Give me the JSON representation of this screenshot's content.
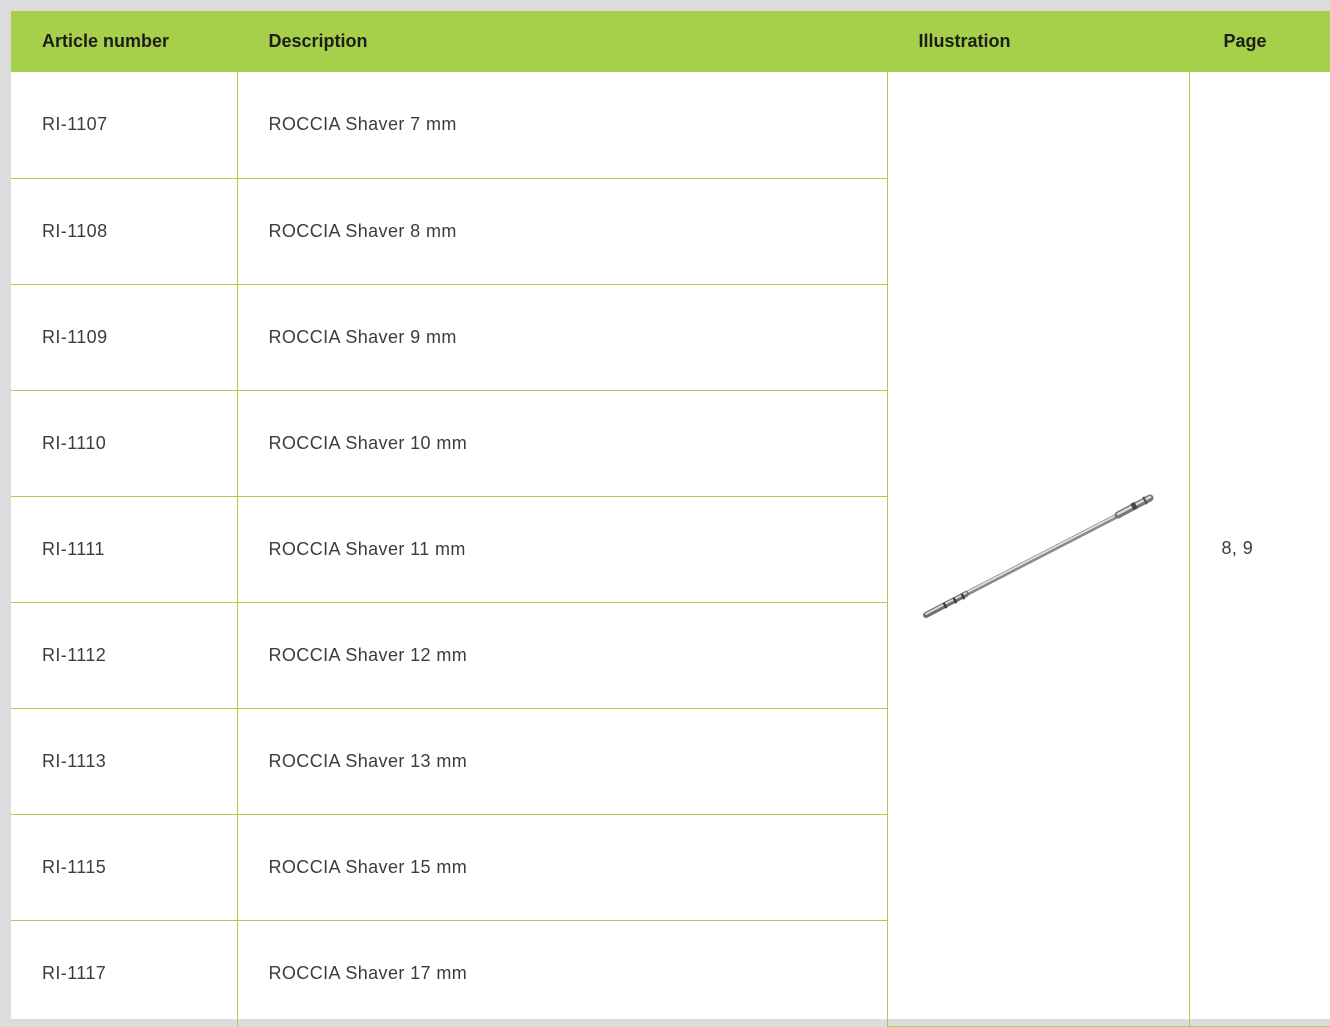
{
  "table": {
    "headers": {
      "article": "Article number",
      "description": "Description",
      "illustration": "Illustration",
      "page": "Page"
    },
    "rows": [
      {
        "article": "RI-1107",
        "description": "ROCCIA Shaver 7 mm"
      },
      {
        "article": "RI-1108",
        "description": "ROCCIA Shaver 8 mm"
      },
      {
        "article": "RI-1109",
        "description": "ROCCIA Shaver 9 mm"
      },
      {
        "article": "RI-1110",
        "description": "ROCCIA Shaver 10 mm"
      },
      {
        "article": "RI-1111",
        "description": "ROCCIA Shaver 11 mm"
      },
      {
        "article": "RI-1112",
        "description": "ROCCIA Shaver 12 mm"
      },
      {
        "article": "RI-1113",
        "description": "ROCCIA Shaver 13 mm"
      },
      {
        "article": "RI-1115",
        "description": "ROCCIA Shaver 15 mm"
      },
      {
        "article": "RI-1117",
        "description": "ROCCIA Shaver 17 mm"
      }
    ],
    "page_ref": "8, 9"
  },
  "colors": {
    "header_bg": "#a6cf4a",
    "border": "#a6cf4a",
    "page_bg": "#dcdcdc"
  },
  "icons": {
    "illustration": "shaver-instrument-image"
  }
}
